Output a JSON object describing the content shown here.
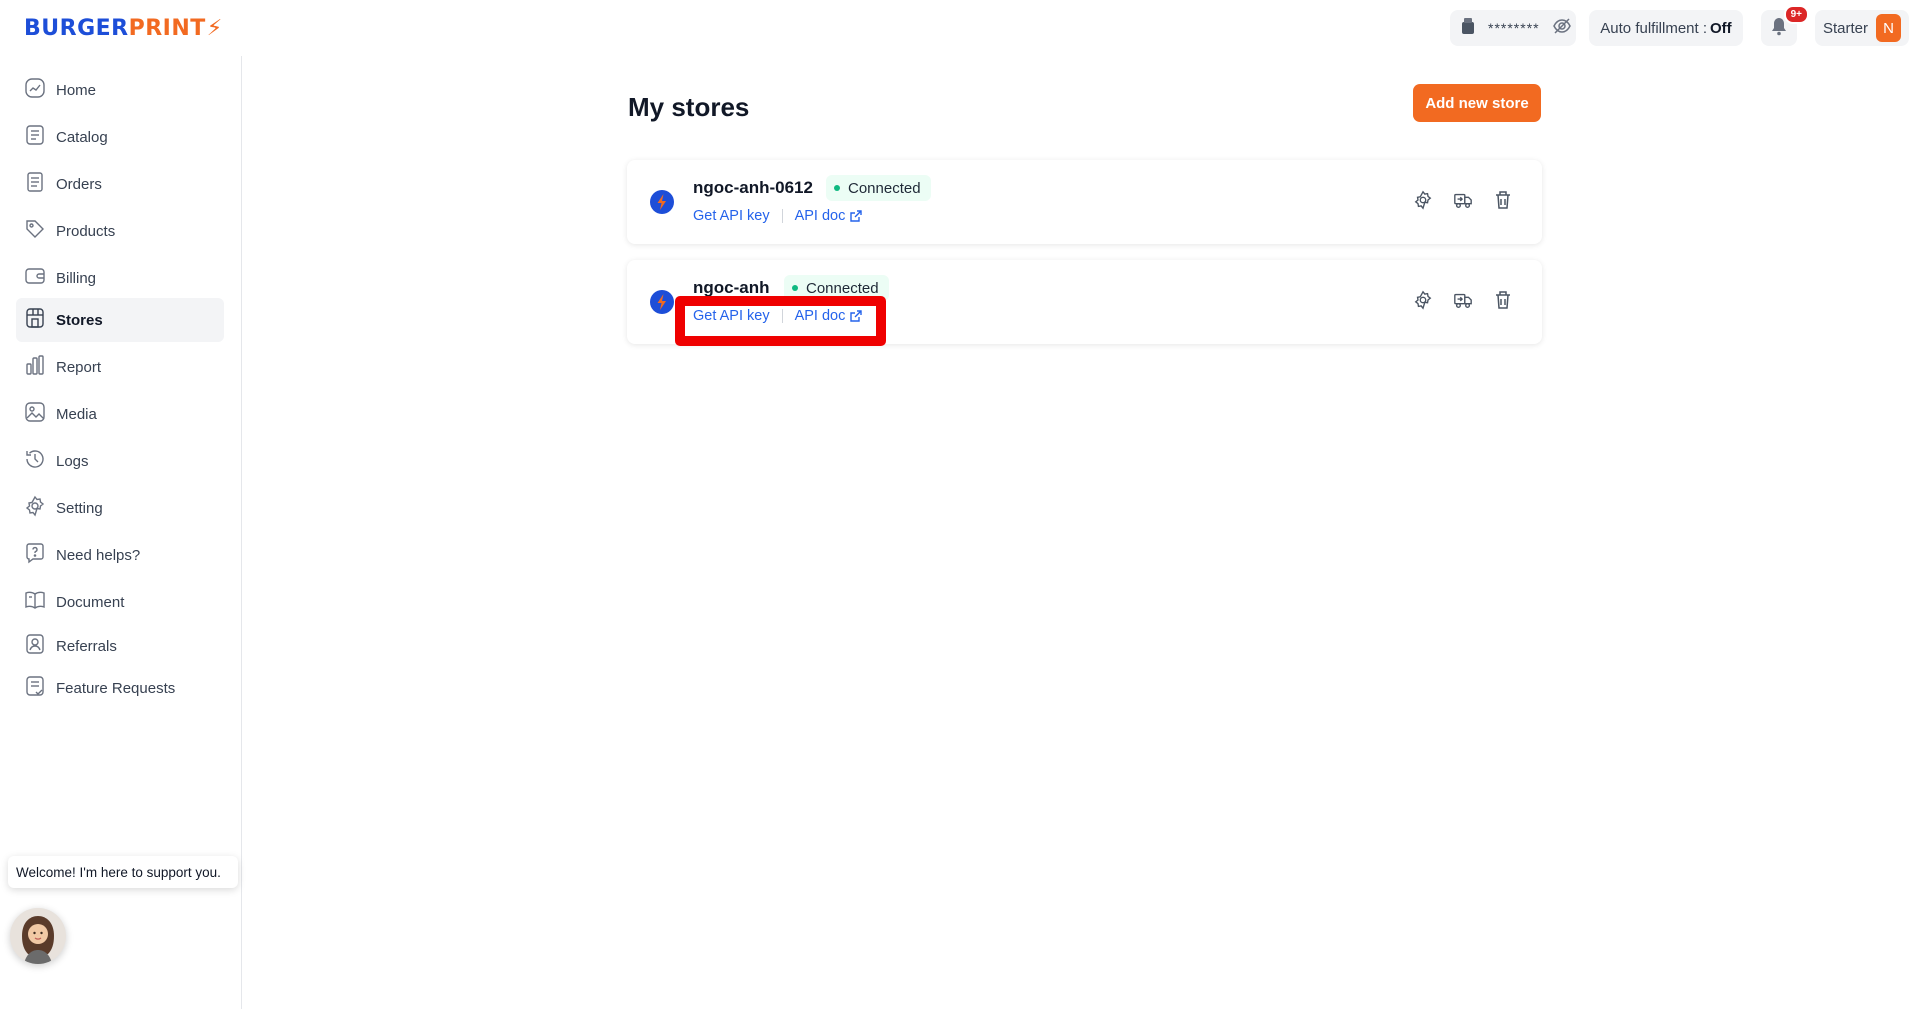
{
  "brand": {
    "part1": "BURGER",
    "part2": "PRINT",
    "bolt": "⚡"
  },
  "header": {
    "wallet_masked": "********",
    "auto_fulfillment_label": "Auto fulfillment :",
    "auto_fulfillment_value": "Off",
    "notification_badge": "9+",
    "plan_label": "Starter",
    "avatar_initial": "N"
  },
  "sidebar": {
    "items": [
      {
        "label": "Home",
        "icon": "home-chart-icon"
      },
      {
        "label": "Catalog",
        "icon": "catalog-icon"
      },
      {
        "label": "Orders",
        "icon": "orders-icon"
      },
      {
        "label": "Products",
        "icon": "tag-icon"
      },
      {
        "label": "Billing",
        "icon": "wallet-icon"
      },
      {
        "label": "Stores",
        "icon": "store-icon",
        "active": true
      },
      {
        "label": "Report",
        "icon": "bar-chart-icon"
      },
      {
        "label": "Media",
        "icon": "image-icon"
      },
      {
        "label": "Logs",
        "icon": "history-icon"
      },
      {
        "label": "Setting",
        "icon": "gear-icon"
      },
      {
        "label": "Need helps?",
        "icon": "help-icon"
      },
      {
        "label": "Document",
        "icon": "book-icon"
      },
      {
        "label": "Referrals",
        "icon": "user-badge-icon"
      },
      {
        "label": "Feature Requests",
        "icon": "feature-request-icon"
      }
    ]
  },
  "chat": {
    "welcome": "Welcome! I'm here to support you."
  },
  "main": {
    "title": "My stores",
    "add_store_label": "Add new store",
    "stores": [
      {
        "name": "ngoc-anh-0612",
        "status": "Connected",
        "get_api_key": "Get API key",
        "api_doc": "API doc"
      },
      {
        "name": "ngoc-anh",
        "status": "Connected",
        "get_api_key": "Get API key",
        "api_doc": "API doc"
      }
    ]
  },
  "colors": {
    "brand_blue": "#1d4ed8",
    "brand_orange": "#f26a21",
    "link_blue": "#2563eb",
    "status_green": "#10b981",
    "highlight_red": "#ef0000"
  }
}
